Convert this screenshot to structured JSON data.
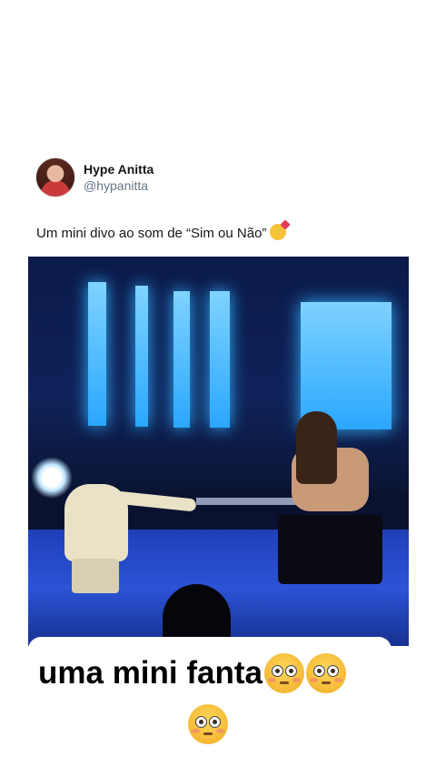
{
  "tweet": {
    "display_name": "Hype Anitta",
    "handle": "@hypanitta",
    "text": "Um mini divo ao som de “Sim ou Não”",
    "text_emoji": "smiling-face-with-hearts"
  },
  "caption": {
    "text": "uma mini fanta",
    "emojis": [
      "flushed-face",
      "flushed-face",
      "flushed-face"
    ]
  },
  "colors": {
    "text_primary": "#14171a",
    "text_secondary": "#657786",
    "stage_blue": "#2aa7ff"
  }
}
